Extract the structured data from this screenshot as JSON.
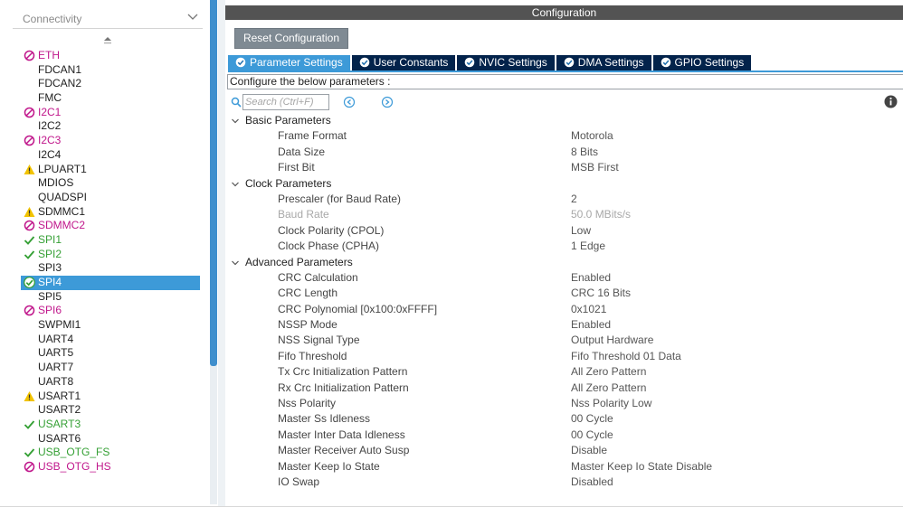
{
  "categories_header": {
    "title": "Connectivity"
  },
  "peripherals": [
    {
      "label": "ETH",
      "status": "error"
    },
    {
      "label": "FDCAN1",
      "status": "none"
    },
    {
      "label": "FDCAN2",
      "status": "none"
    },
    {
      "label": "FMC",
      "status": "none"
    },
    {
      "label": "I2C1",
      "status": "error"
    },
    {
      "label": "I2C2",
      "status": "none"
    },
    {
      "label": "I2C3",
      "status": "error"
    },
    {
      "label": "I2C4",
      "status": "none"
    },
    {
      "label": "LPUART1",
      "status": "warning"
    },
    {
      "label": "MDIOS",
      "status": "none"
    },
    {
      "label": "QUADSPI",
      "status": "none"
    },
    {
      "label": "SDMMC1",
      "status": "warning"
    },
    {
      "label": "SDMMC2",
      "status": "error"
    },
    {
      "label": "SPI1",
      "status": "ok"
    },
    {
      "label": "SPI2",
      "status": "ok"
    },
    {
      "label": "SPI3",
      "status": "none"
    },
    {
      "label": "SPI4",
      "status": "ok-selected"
    },
    {
      "label": "SPI5",
      "status": "none"
    },
    {
      "label": "SPI6",
      "status": "error"
    },
    {
      "label": "SWPMI1",
      "status": "none"
    },
    {
      "label": "UART4",
      "status": "none"
    },
    {
      "label": "UART5",
      "status": "none"
    },
    {
      "label": "UART7",
      "status": "none"
    },
    {
      "label": "UART8",
      "status": "none"
    },
    {
      "label": "USART1",
      "status": "warning"
    },
    {
      "label": "USART2",
      "status": "none"
    },
    {
      "label": "USART3",
      "status": "ok"
    },
    {
      "label": "USART6",
      "status": "none"
    },
    {
      "label": "USB_OTG_FS",
      "status": "ok"
    },
    {
      "label": "USB_OTG_HS",
      "status": "error"
    }
  ],
  "configuration": {
    "title": "Configuration",
    "reset_label": "Reset Configuration",
    "tabs": [
      {
        "label": "Parameter Settings",
        "active": true
      },
      {
        "label": "User Constants",
        "active": false
      },
      {
        "label": "NVIC Settings",
        "active": false
      },
      {
        "label": "DMA Settings",
        "active": false
      },
      {
        "label": "GPIO Settings",
        "active": false
      }
    ],
    "description": "Configure the below parameters :",
    "search_placeholder": "Search (Ctrl+F)",
    "groups": [
      {
        "title": "Basic Parameters",
        "params": [
          {
            "name": "Frame Format",
            "value": "Motorola"
          },
          {
            "name": "Data Size",
            "value": "8 Bits"
          },
          {
            "name": "First Bit",
            "value": "MSB First"
          }
        ]
      },
      {
        "title": "Clock Parameters",
        "params": [
          {
            "name": "Prescaler (for Baud Rate)",
            "value": "2"
          },
          {
            "name": "Baud Rate",
            "value": "50.0 MBits/s",
            "disabled": true
          },
          {
            "name": "Clock Polarity (CPOL)",
            "value": "Low"
          },
          {
            "name": "Clock Phase (CPHA)",
            "value": "1 Edge"
          }
        ]
      },
      {
        "title": "Advanced Parameters",
        "params": [
          {
            "name": "CRC Calculation",
            "value": "Enabled"
          },
          {
            "name": "CRC Length",
            "value": "CRC 16 Bits"
          },
          {
            "name": "CRC Polynomial [0x100:0xFFFF]",
            "value": "0x1021"
          },
          {
            "name": "NSSP Mode",
            "value": "Enabled"
          },
          {
            "name": "NSS Signal Type",
            "value": "Output Hardware"
          },
          {
            "name": "Fifo Threshold",
            "value": "Fifo Threshold 01 Data"
          },
          {
            "name": "Tx Crc Initialization Pattern",
            "value": "All Zero Pattern"
          },
          {
            "name": "Rx Crc Initialization Pattern",
            "value": "All Zero Pattern"
          },
          {
            "name": "Nss Polarity",
            "value": "Nss Polarity Low"
          },
          {
            "name": "Master Ss Idleness",
            "value": "00 Cycle"
          },
          {
            "name": "Master Inter Data Idleness",
            "value": "00 Cycle"
          },
          {
            "name": "Master Receiver Auto Susp",
            "value": "Disable"
          },
          {
            "name": "Master Keep Io State",
            "value": "Master Keep Io State Disable"
          },
          {
            "name": "IO Swap",
            "value": "Disabled"
          }
        ]
      }
    ]
  },
  "colors": {
    "error": "#c0168b",
    "ok": "#35a035",
    "warning": "#f2c300",
    "selected": "#3d9ad8",
    "tab_inactive": "#03234b",
    "title_bar": "#535353"
  },
  "icons": {
    "error": "forbidden-icon",
    "ok": "check-icon",
    "warning": "warning-triangle-icon",
    "tab": "check-circle-icon",
    "info": "info-icon"
  }
}
